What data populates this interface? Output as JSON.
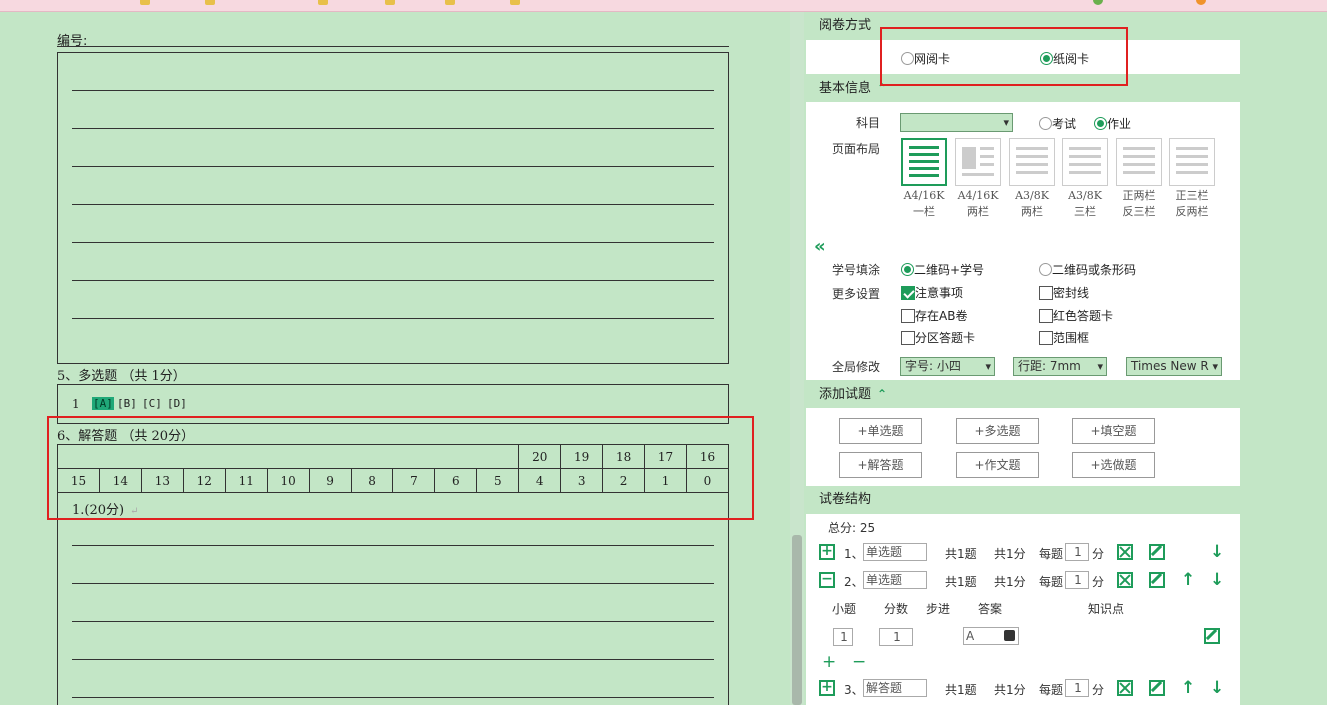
{
  "sheet": {
    "serial_label": "编号:",
    "section5_title": "5、多选题  （共 1分）",
    "mc": {
      "num": "1",
      "options": [
        "[A]",
        "[B]",
        "[C]",
        "[D]"
      ]
    },
    "section6_title": "6、解答题  （共 20分）",
    "score_row1": [
      "20",
      "19",
      "18",
      "17",
      "16"
    ],
    "score_row2": [
      "15",
      "14",
      "13",
      "12",
      "11",
      "10",
      "9",
      "8",
      "7",
      "6",
      "5",
      "4",
      "3",
      "2",
      "1",
      "0"
    ],
    "question_label": "1.(20分)",
    "return_mark": "↵"
  },
  "panel": {
    "review": {
      "header": "阅卷方式",
      "options": [
        "网阅卡",
        "纸阅卡"
      ],
      "selected": "纸阅卡"
    },
    "basic": {
      "header": "基本信息",
      "subject_label": "科目",
      "subject_value": "",
      "type_options": [
        "考试",
        "作业"
      ],
      "type_selected": "作业",
      "layout_label": "页面布局",
      "layouts": [
        {
          "l1": "A4/16K",
          "l2": "一栏"
        },
        {
          "l1": "A4/16K",
          "l2": "两栏"
        },
        {
          "l1": "A3/8K",
          "l2": "两栏"
        },
        {
          "l1": "A3/8K",
          "l2": "三栏"
        },
        {
          "l1": "正两栏",
          "l2": "反三栏"
        },
        {
          "l1": "正三栏",
          "l2": "反两栏"
        }
      ],
      "collapse_glyph": "«",
      "id_label": "学号填涂",
      "id_options": [
        "二维码+学号",
        "二维码或条形码"
      ],
      "more_label": "更多设置",
      "more_options": [
        {
          "label": "注意事项",
          "checked": true
        },
        {
          "label": "密封线",
          "checked": false
        },
        {
          "label": "存在AB卷",
          "checked": false
        },
        {
          "label": "红色答题卡",
          "checked": false
        },
        {
          "label": "分区答题卡",
          "checked": false
        },
        {
          "label": "范围框",
          "checked": false
        }
      ],
      "global_label": "全局修改",
      "font_size": "字号: 小四",
      "line_spacing": "行距: 7mm",
      "font_family": "Times New R"
    },
    "add": {
      "header": "添加试题",
      "buttons": [
        "+单选题",
        "+多选题",
        "+填空题",
        "+解答题",
        "+作文题",
        "+选做题"
      ]
    },
    "structure": {
      "header": "试卷结构",
      "total": "总分: 25",
      "rows": [
        {
          "num": "1、",
          "name": "单选题",
          "count": "共1题",
          "score": "共1分",
          "per": "每题",
          "per_value": "1",
          "unit": "分"
        },
        {
          "num": "2、",
          "name": "单选题",
          "count": "共1题",
          "score": "共1分",
          "per": "每题",
          "per_value": "1",
          "unit": "分"
        },
        {
          "num": "3、",
          "name": "解答题",
          "count": "共1题",
          "score": "共1分",
          "per": "每题",
          "per_value": "1",
          "unit": "分"
        }
      ],
      "sub_headers": [
        "小题",
        "分数",
        "步进",
        "答案",
        "知识点"
      ],
      "sub_row": {
        "num": "1",
        "score": "1",
        "answer": "A"
      },
      "plus": "+",
      "minus": "−"
    }
  },
  "colors": {
    "accent": "#1e9c5a",
    "highlight": "#e02020",
    "bg": "#c3e6c6"
  }
}
